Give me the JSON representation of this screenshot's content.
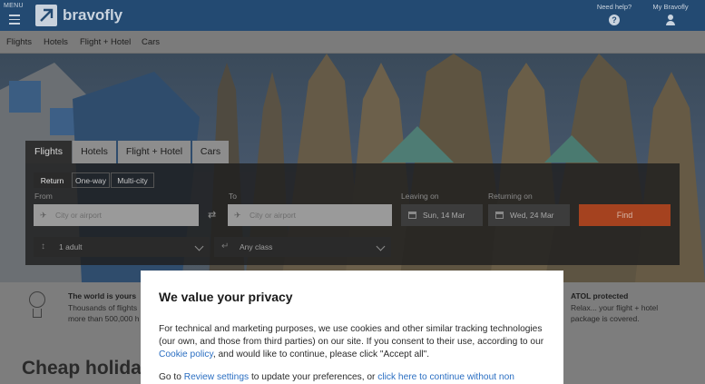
{
  "header": {
    "menu_label": "MENU",
    "logo_text": "bravofly",
    "help_label": "Need help?",
    "help_icon": "question-icon",
    "account_label": "My Bravofly",
    "account_icon": "user-icon"
  },
  "subnav": {
    "items": [
      "Flights",
      "Hotels",
      "Flight + Hotel",
      "Cars"
    ]
  },
  "search": {
    "tabs": [
      "Flights",
      "Hotels",
      "Flight + Hotel",
      "Cars"
    ],
    "trip_types": [
      "Return",
      "One-way",
      "Multi-city"
    ],
    "from_label": "From",
    "to_label": "To",
    "from_placeholder": "City or airport",
    "to_placeholder": "City or airport",
    "leaving_label": "Leaving on",
    "returning_label": "Returning on",
    "leaving_value": "Sun, 14 Mar",
    "returning_value": "Wed, 24 Mar",
    "find_label": "Find",
    "passengers_value": "1 adult",
    "class_value": "Any class"
  },
  "features": {
    "world_title": "The world is yours",
    "world_text_1": "Thousands of flights",
    "world_text_2": "more than 500,000 h",
    "atol_title": "ATOL protected",
    "atol_text_1": "Relax... your flight + hotel",
    "atol_text_2": "package is covered."
  },
  "headline": "Cheap holidays",
  "cookie": {
    "title": "We value your privacy",
    "body_1": "For technical and marketing purposes, we use cookies and other similar tracking technologies (our own, and those from third parties) on our site. If you consent to their use, according to our",
    "cookie_policy_link": "Cookie policy",
    "body_2": ", and would like to continue, please click \"Accept all\".",
    "foot_1": "Go to",
    "review_link": "Review settings",
    "foot_2": "to update your preferences, or",
    "continue_link": "click here to continue without non"
  },
  "colors": {
    "header_bg": "#234a72",
    "find_button": "#a5421f",
    "link": "#2a6ec2"
  }
}
